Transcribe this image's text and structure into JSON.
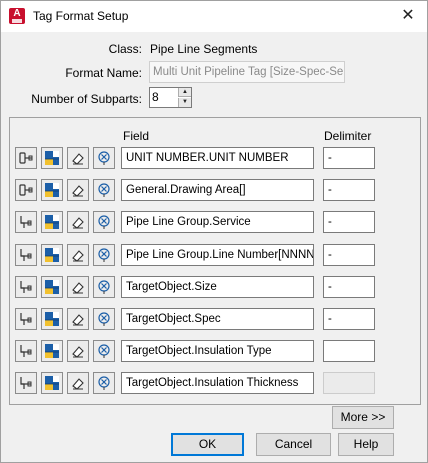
{
  "window": {
    "title": "Tag Format Setup",
    "app_icon_letter": "A",
    "close_glyph": "✕"
  },
  "info": {
    "class_label": "Class:",
    "class_value": "Pipe Line Segments",
    "format_label": "Format Name:",
    "format_value": "Multi Unit Pipeline Tag [Size-Spec-Servic",
    "subparts_label": "Number of Subparts:",
    "subparts_value": "8"
  },
  "columns": {
    "field": "Field",
    "delimiter": "Delimiter"
  },
  "rows": [
    {
      "field": "UNIT NUMBER.UNIT NUMBER",
      "delimiter": "-",
      "delimiter_disabled": false,
      "property_icon": "pipe-plain-icon"
    },
    {
      "field": "General.Drawing Area[]",
      "delimiter": "-",
      "delimiter_disabled": false,
      "property_icon": "pipe-plain-icon"
    },
    {
      "field": "Pipe Line Group.Service",
      "delimiter": "-",
      "delimiter_disabled": false,
      "property_icon": "pipe-tee-icon"
    },
    {
      "field": "Pipe Line Group.Line Number[NNNN]",
      "delimiter": "-",
      "delimiter_disabled": false,
      "property_icon": "pipe-tee-icon"
    },
    {
      "field": "TargetObject.Size",
      "delimiter": "-",
      "delimiter_disabled": false,
      "property_icon": "pipe-tee-icon"
    },
    {
      "field": "TargetObject.Spec",
      "delimiter": "-",
      "delimiter_disabled": false,
      "property_icon": "pipe-tee-icon"
    },
    {
      "field": "TargetObject.Insulation Type",
      "delimiter": "",
      "delimiter_disabled": false,
      "property_icon": "pipe-tee-icon"
    },
    {
      "field": "TargetObject.Insulation Thickness",
      "delimiter": "",
      "delimiter_disabled": true,
      "property_icon": "pipe-tee-icon"
    }
  ],
  "buttons": {
    "more": "More >>",
    "ok": "OK",
    "cancel": "Cancel",
    "help": "Help"
  },
  "colors": {
    "accent": "#0078d7",
    "icon_blue": "#1c5fa8",
    "icon_yellow": "#f2c12e",
    "brand_red": "#c8102e"
  }
}
